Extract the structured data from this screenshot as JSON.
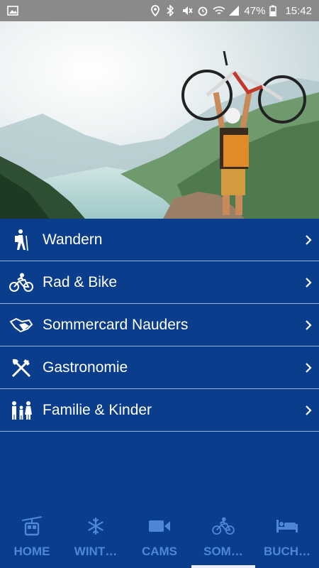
{
  "status_bar": {
    "battery_percent": "47%",
    "time": "15:42",
    "icons": [
      "image-icon",
      "location-icon",
      "bluetooth-icon",
      "mute-icon",
      "alarm-icon",
      "wifi-icon",
      "signal-icon",
      "battery-icon"
    ]
  },
  "hero": {
    "description_icon": "mountain-biker-photo"
  },
  "menu": {
    "items": [
      {
        "label": "Wandern",
        "icon": "hiking-icon"
      },
      {
        "label": "Rad & Bike",
        "icon": "bike-icon"
      },
      {
        "label": "Sommercard Nauders",
        "icon": "handshake-card-icon"
      },
      {
        "label": "Gastronomie",
        "icon": "cutlery-icon"
      },
      {
        "label": "Familie & Kinder",
        "icon": "family-icon"
      }
    ]
  },
  "bottom_nav": {
    "tabs": [
      {
        "label": "HOME",
        "icon": "gondola-icon"
      },
      {
        "label": "WINT…",
        "icon": "snowflake-icon"
      },
      {
        "label": "CAMS",
        "icon": "camera-icon"
      },
      {
        "label": "SOM…",
        "icon": "bike-icon",
        "active": true
      },
      {
        "label": "BUCH…",
        "icon": "bed-icon"
      }
    ]
  },
  "colors": {
    "background": "#0a3d8c",
    "nav_accent": "#4e86d8",
    "status_bar": "#8a8a8a"
  }
}
